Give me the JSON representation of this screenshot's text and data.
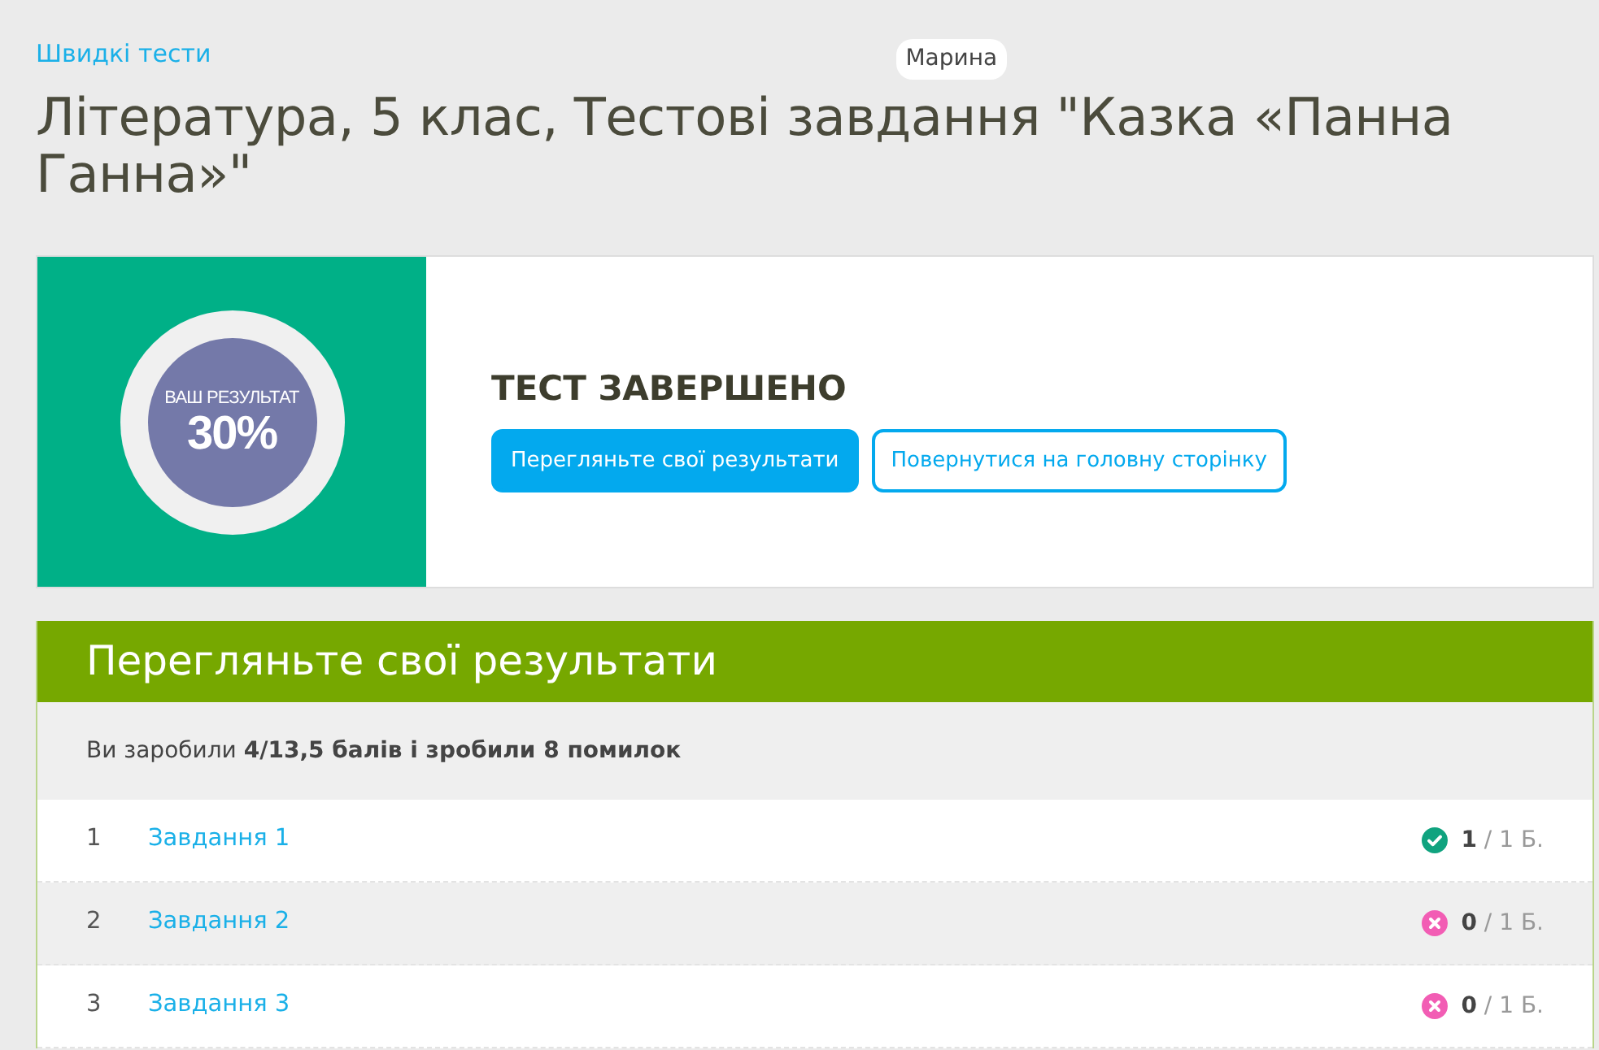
{
  "breadcrumb": "Швидкі тести",
  "user": "Марина",
  "title": "Література, 5 клас, Тестові завдання \"Казка «Панна Ганна»\"",
  "result": {
    "label": "ВАШ РЕЗУЛЬТАТ",
    "percent": "30%",
    "heading": "ТЕСТ ЗАВЕРШЕНО",
    "buttons": [
      {
        "label": "Перегляньте свої результати",
        "kind": "primary"
      },
      {
        "label": "Повернутися на головну сторінку",
        "kind": "outline"
      }
    ]
  },
  "results": {
    "heading": "Перегляньте свої результати",
    "summary": "Ви заробили **4/13,5 балів і зробили 8 помилок**",
    "rows": [
      {
        "number": "1",
        "task": "Завдання 1",
        "kind": "correct",
        "score": "**1** / 1 Б."
      },
      {
        "number": "2",
        "task": "Завдання 2",
        "kind": "wrong",
        "score": "**0** / 1 Б."
      },
      {
        "number": "3",
        "task": "Завдання 3",
        "kind": "wrong",
        "score": "**0** / 1 Б."
      }
    ]
  }
}
